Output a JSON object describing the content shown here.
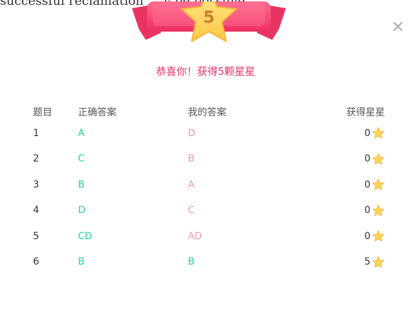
{
  "background": {
    "partial_text": "successful reclamation … y be possible"
  },
  "modal": {
    "badge_number": "5",
    "title": "恭喜你！获得5颗星星",
    "close_symbol": "×",
    "colors": {
      "title": "#e8346a",
      "correct": "#2ad29b",
      "wrong": "#f59aa0",
      "ribbon": "#f2456f",
      "star": "#ffd45a"
    }
  },
  "table": {
    "headers": {
      "question": "题目",
      "correct": "正确答案",
      "mine": "我的答案",
      "stars": "获得星星"
    },
    "rows": [
      {
        "q": "1",
        "correct": "A",
        "mine": "D",
        "stars": "0",
        "is_correct": false
      },
      {
        "q": "2",
        "correct": "C",
        "mine": "B",
        "stars": "0",
        "is_correct": false
      },
      {
        "q": "3",
        "correct": "B",
        "mine": "A",
        "stars": "0",
        "is_correct": false
      },
      {
        "q": "4",
        "correct": "D",
        "mine": "C",
        "stars": "0",
        "is_correct": false
      },
      {
        "q": "5",
        "correct": "CD",
        "mine": "AD",
        "stars": "0",
        "is_correct": false
      },
      {
        "q": "6",
        "correct": "B",
        "mine": "B",
        "stars": "5",
        "is_correct": true
      }
    ],
    "star_icon": "star-icon"
  }
}
